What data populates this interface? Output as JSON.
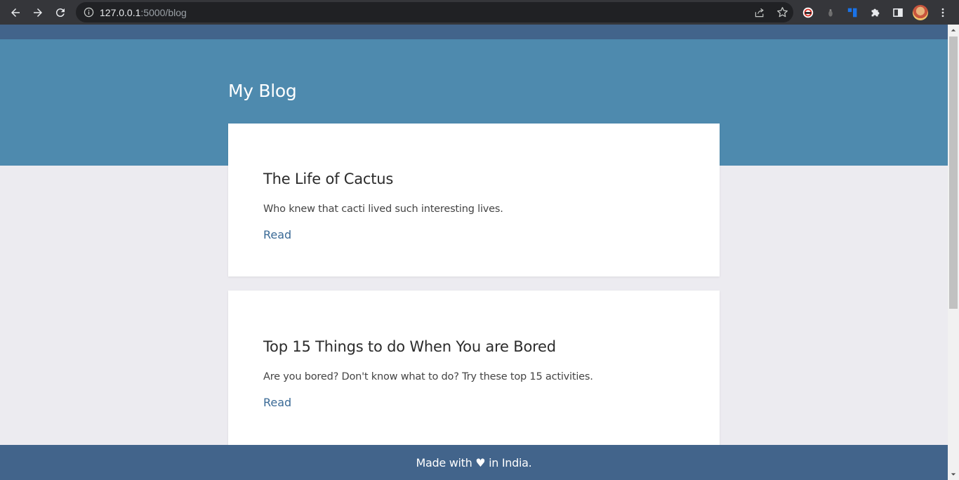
{
  "browser": {
    "url_host": "127.0.0.1",
    "url_path": ":5000/blog"
  },
  "page": {
    "site_title": "My Blog",
    "posts": [
      {
        "title": "The Life of Cactus",
        "excerpt": "Who knew that cacti lived such interesting lives.",
        "link_label": "Read"
      },
      {
        "title": "Top 15 Things to do When You are Bored",
        "excerpt": "Are you bored? Don't know what to do? Try these top 15 activities.",
        "link_label": "Read"
      }
    ],
    "footer_text": "Made with ♥ in India."
  },
  "colors": {
    "chrome_bg": "#35363a",
    "omnibox_bg": "#202124",
    "top_strip": "#42648b",
    "hero_bg": "#4e8aae",
    "page_bg": "#ecebf0",
    "link": "#3a6a96",
    "footer_bg": "#42648b"
  },
  "icons": [
    "back-arrow-icon",
    "forward-arrow-icon",
    "reload-icon",
    "info-icon",
    "share-icon",
    "star-icon",
    "extension-icon",
    "puzzle-icon",
    "side-panel-icon",
    "kebab-menu-icon"
  ]
}
